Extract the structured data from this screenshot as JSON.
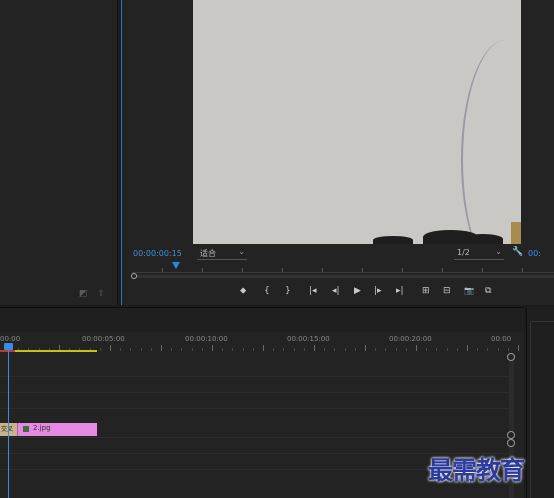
{
  "monitor": {
    "timecode": "00:00:00:15",
    "fit": "适合",
    "resolution": "1/2",
    "timecode_right": "00:"
  },
  "transport": {
    "marker": "⬥",
    "in": "{",
    "out": "}",
    "go_in": "|◂",
    "step_back": "◂|",
    "play": "▶",
    "step_fwd": "|▸",
    "go_out": "▸|",
    "insert": "⊞",
    "overwrite": "⊟",
    "export": "📷",
    "compare": "⧉"
  },
  "timeline": {
    "ruler": [
      "00:00",
      "00:00:05:00",
      "00:00:10:00",
      "00:00:15:00",
      "00:00:20:00",
      "00:00"
    ],
    "clip_fx_label": "交叉溶",
    "clip_name": "2.jpg"
  },
  "watermark": "最需教育",
  "colors": {
    "accent": "#3e8ee8",
    "clip": "#e58ae3",
    "workbar": "#c9c21e"
  }
}
